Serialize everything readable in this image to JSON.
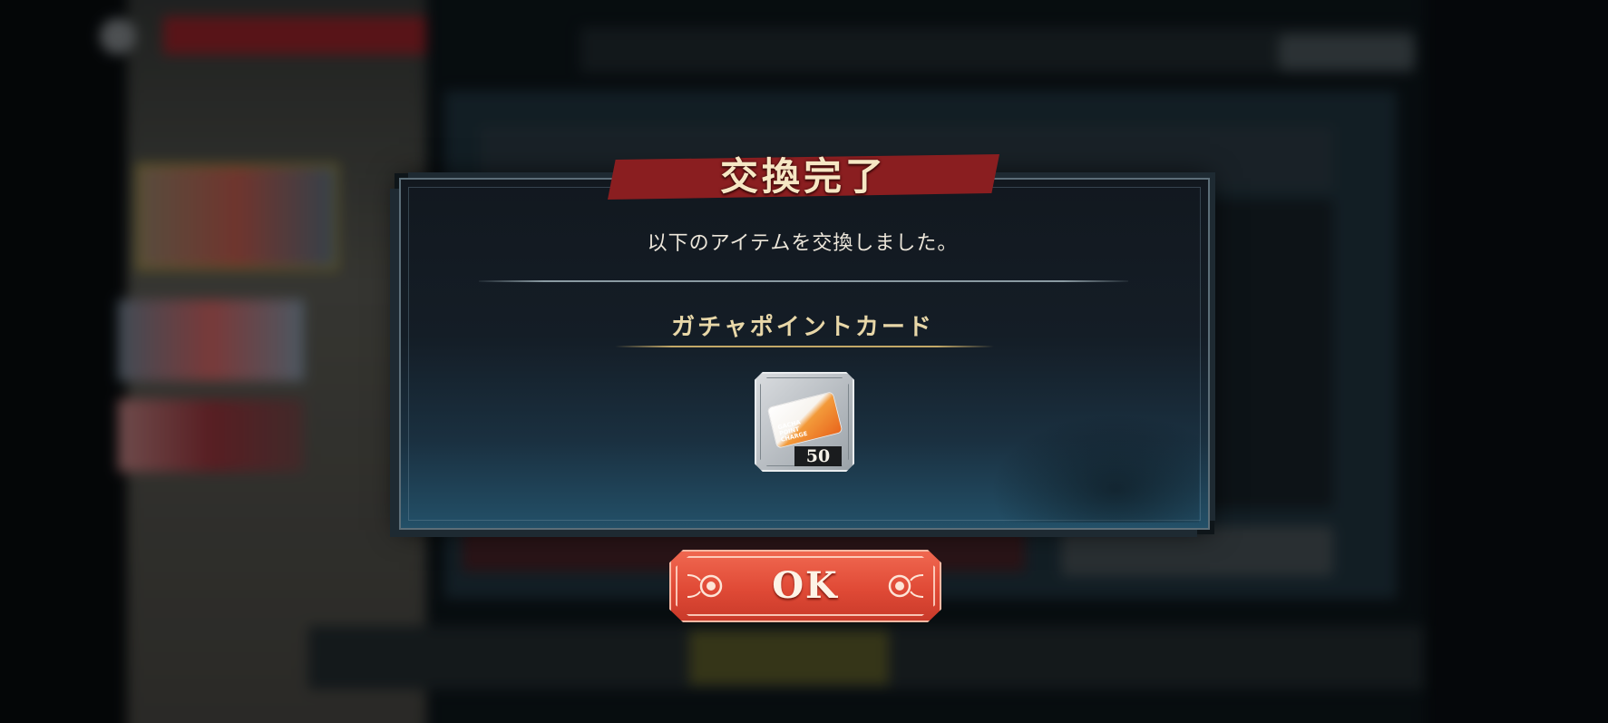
{
  "dialog": {
    "title": "交換完了",
    "message": "以下のアイテムを交換しました。",
    "item": {
      "name": "ガチャポイントカード",
      "quantity": "50",
      "card_text": "GACHA POINT CHARGE"
    },
    "ok_button": {
      "label": "OK"
    }
  },
  "colors": {
    "title_banner": "#8a1e20",
    "ok_button": "#e04a36",
    "item_name": "#e8d7a8"
  }
}
